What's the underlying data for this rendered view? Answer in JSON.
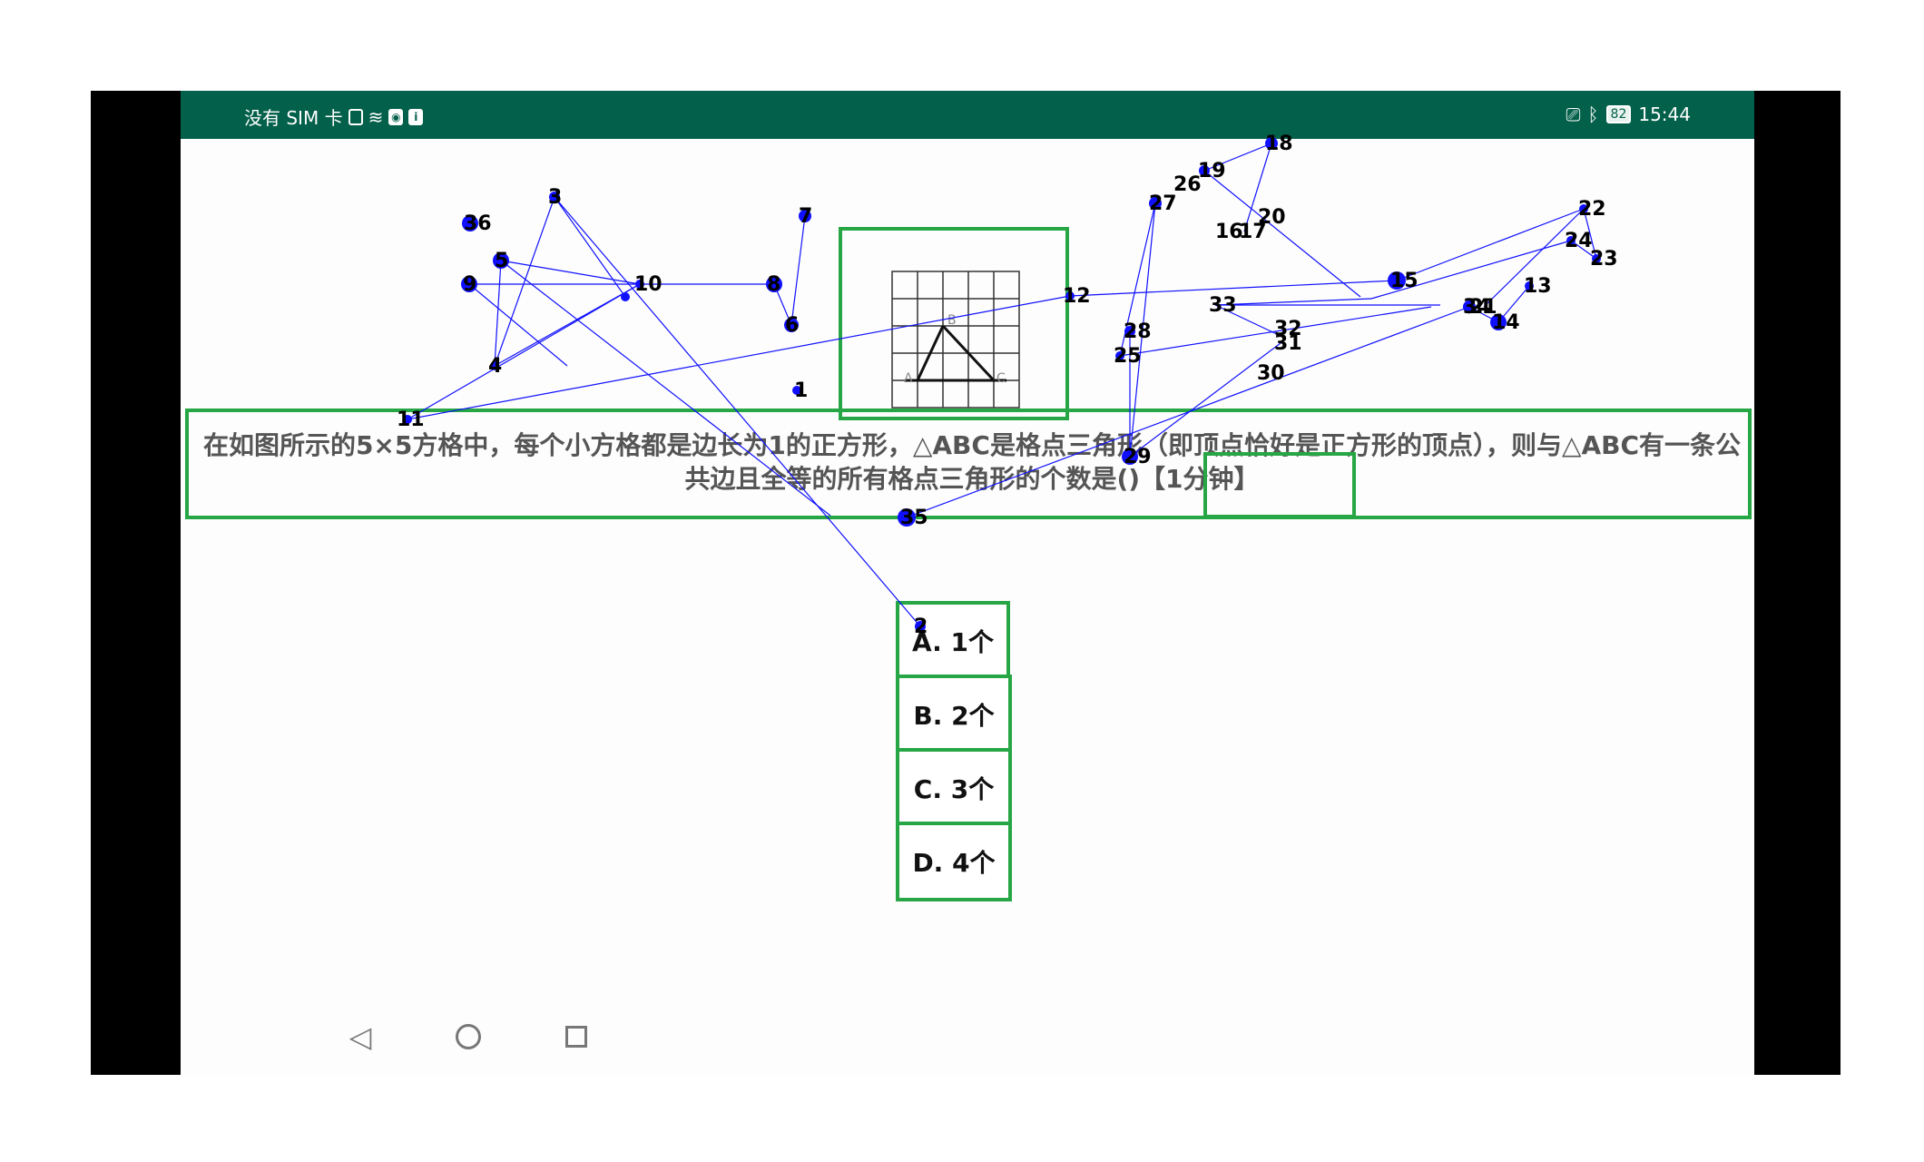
{
  "status_bar": {
    "left_text": "没有 SIM 卡",
    "left_icons": [
      "sim-card-icon",
      "wifi-icon",
      "app-notification-icon",
      "info-notification-icon"
    ],
    "right_icons": [
      "cast-icon",
      "bluetooth-icon"
    ],
    "battery": "82",
    "time": "15:44"
  },
  "question": {
    "text": "在如图所示的5×5方格中，每个小方格都是边长为1的正方形，△ABC是格点三角形（即顶点恰好是正方形的顶点），则与△ABC有一条公共边且全等的所有格点三角形的个数是()【1分钟】",
    "figure_labels": {
      "a": "A",
      "b": "B",
      "c": "C"
    }
  },
  "options": [
    {
      "label": "A. 1个"
    },
    {
      "label": "B. 2个"
    },
    {
      "label": "C. 3个"
    },
    {
      "label": "D. 4个"
    }
  ],
  "navbar": {
    "back": "◁",
    "home": "○",
    "recent": "□"
  },
  "markers": [
    "1",
    "2",
    "3",
    "4",
    "5",
    "6",
    "7",
    "8",
    "9",
    "10",
    "11",
    "12",
    "13",
    "14",
    "15",
    "16",
    "17",
    "18",
    "19",
    "20",
    "21",
    "22",
    "23",
    "24",
    "25",
    "26",
    "27",
    "28",
    "29",
    "30",
    "31",
    "32",
    "33",
    "34",
    "35",
    "36"
  ],
  "accent_colors": {
    "status_bar": "#03604a",
    "box": "#27a645",
    "overlay": "#0000ff"
  }
}
